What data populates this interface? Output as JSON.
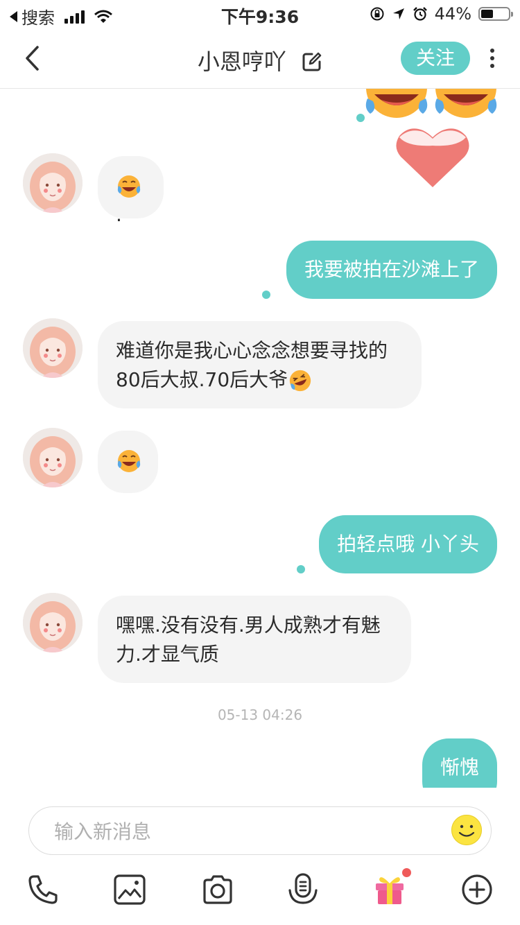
{
  "status_bar": {
    "back_app": "搜索",
    "time": "下午9:36",
    "battery_text": "44%",
    "battery_level": 0.44
  },
  "nav": {
    "title": "小恩哼吖",
    "follow_label": "关注"
  },
  "messages": [
    {
      "side": "in",
      "text": "",
      "emoji": "joy-tears-emoji",
      "suffix": "."
    },
    {
      "side": "out",
      "text": "我要被拍在沙滩上了"
    },
    {
      "side": "in",
      "line1": "难道你是我心心念念想要寻找的",
      "line2": "80后大叔.70后大爷",
      "emoji": "rofl-emoji"
    },
    {
      "side": "in",
      "text": "",
      "emoji": "joy-tears-emoji"
    },
    {
      "side": "out",
      "text": "拍轻点哦 小丫头"
    },
    {
      "side": "in",
      "line1": "嘿嘿.没有没有.男人成熟才有魅",
      "line2": "力.才显气质"
    },
    {
      "side": "out",
      "text": "惭愧"
    }
  ],
  "timestamp": "05-13 04:26",
  "input": {
    "placeholder": "输入新消息"
  },
  "toolbar": [
    "phone-icon",
    "image-icon",
    "camera-icon",
    "voice-icon",
    "gift-icon",
    "plus-icon"
  ],
  "colors": {
    "accent": "#62cec8",
    "bubble_in": "#f4f4f4",
    "heart": "#ee7b76",
    "badge": "#ef5a5a"
  }
}
